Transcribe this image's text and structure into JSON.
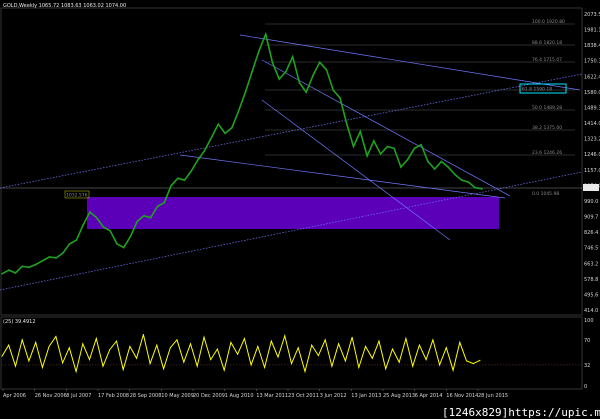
{
  "header": {
    "price_info": "GOLD,Weekly  1065.72 1083.63 1063.02 1074.00",
    "indicator_info": "(25) 39.4912"
  },
  "watermark": "[1246x829]https://upic.me/",
  "colors": {
    "background": "#000000",
    "price_line": "#1fa31f",
    "indicator_line": "#ffff00",
    "trend_lines": "#6f78ff",
    "support_box": "#5b00b8",
    "fib_lines": "#5a5a5a",
    "highlight_box": "#00e6ff",
    "axis_text": "#d6d6d6"
  },
  "annotations": {
    "box_label": "1032.576",
    "fib_levels": [
      "100.0 1920.80",
      "88.6 1820.18",
      "76.4 1715.07",
      "61.8 1590.18",
      "50.0 1489.28",
      "38.2 1375.00",
      "23.6 1246.26",
      "0.0 1045.98"
    ]
  },
  "chart_data": [
    {
      "type": "line",
      "title": "",
      "series": [
        {
          "values": [
            620,
            640,
            625,
            660,
            655,
            670,
            690,
            710,
            705,
            730,
            780,
            800,
            880,
            950,
            920,
            870,
            850,
            780,
            760,
            820,
            900,
            930,
            920,
            980,
            1000,
            1090,
            1130,
            1120,
            1170,
            1230,
            1280,
            1350,
            1420,
            1370,
            1400,
            1490,
            1590,
            1700,
            1810,
            1900,
            1750,
            1660,
            1700,
            1780,
            1640,
            1590,
            1680,
            1750,
            1710,
            1600,
            1560,
            1420,
            1300,
            1380,
            1250,
            1330,
            1260,
            1300,
            1290,
            1190,
            1230,
            1290,
            1310,
            1220,
            1180,
            1220,
            1190,
            1150,
            1120,
            1110,
            1080,
            1074
          ]
        }
      ],
      "xlim": [
        "2006-04",
        "2015-11"
      ],
      "ylim": [
        400,
        2040
      ],
      "x_tick_labels": [
        "Apr 2006",
        "26 Nov 2006",
        "8 Jul 2007",
        "17 Feb 2008",
        "28 Sep 2008",
        "10 May 2009",
        "20 Dec 2009",
        "1 Aug 2010",
        "13 Mar 2011",
        "23 Oct 2011",
        "3 Jun 2012",
        "13 Jan 2013",
        "25 Aug 2013",
        "6 Apr 2014",
        "16 Nov 2014",
        "28 Jun 2015"
      ],
      "y_tick_labels": [
        "2073.5",
        "1981.1",
        "1838.4",
        "1750.3",
        "1622.4",
        "1580.0",
        "1489.3",
        "1414.0",
        "1323.2",
        "1246.0",
        "1157.0",
        "1074.0",
        "990.0",
        "909.7",
        "826.4",
        "746.5",
        "663.2",
        "578.8",
        "495.6",
        "414.0"
      ],
      "grid": false,
      "legend": "none"
    },
    {
      "type": "line",
      "title": "",
      "series": [
        {
          "values": [
            45,
            62,
            30,
            70,
            38,
            66,
            28,
            60,
            75,
            35,
            58,
            22,
            64,
            40,
            72,
            30,
            55,
            68,
            25,
            60,
            42,
            78,
            34,
            62,
            26,
            58,
            70,
            36,
            64,
            30,
            74,
            40,
            56,
            24,
            66,
            48,
            72,
            32,
            60,
            28,
            68,
            44,
            76,
            34,
            58,
            22,
            62,
            46,
            70,
            30,
            64,
            38,
            74,
            28,
            60,
            42,
            68,
            26,
            56,
            36,
            72,
            30,
            62,
            40,
            70,
            32,
            58,
            24,
            66,
            38,
            34,
            39
          ]
        }
      ],
      "y_tick_labels": [
        "100",
        "70",
        "32",
        "0"
      ],
      "grid": false,
      "legend": "none"
    }
  ]
}
